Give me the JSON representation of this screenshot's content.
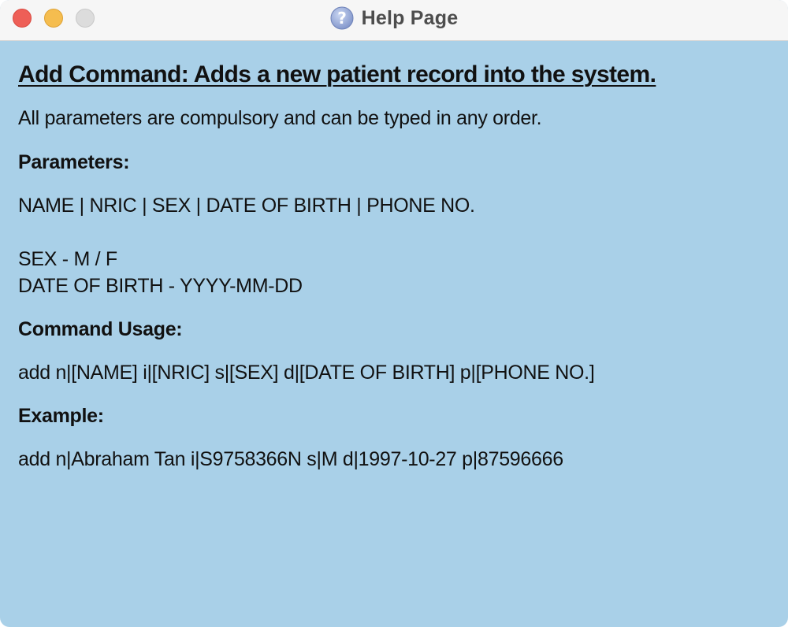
{
  "window": {
    "title": "Help Page",
    "controls": [
      "close",
      "minimize",
      "zoom"
    ]
  },
  "help": {
    "heading": "Add Command: Adds a new patient record into the system.",
    "intro": "All parameters are compulsory and can be typed in any order.",
    "parameters_label": "Parameters:",
    "parameters": "NAME | NRIC | SEX | DATE OF BIRTH | PHONE NO.",
    "sex_format": "SEX - M / F",
    "dob_format": "DATE OF BIRTH - YYYY-MM-DD",
    "usage_label": "Command Usage:",
    "usage": "add n|[NAME] i|[NRIC] s|[SEX] d|[DATE OF BIRTH] p|[PHONE NO.]",
    "example_label": "Example:",
    "example": "add n|Abraham Tan i|S9758366N s|M d|1997-10-27 p|87596666"
  },
  "colors": {
    "background": "#a9d0e8",
    "titlebar": "#f6f6f6",
    "close": "#ee5f57",
    "minimize": "#f5bd4f",
    "zoom": "#dcdcdc"
  },
  "icons": {
    "title": "help-question-icon"
  }
}
